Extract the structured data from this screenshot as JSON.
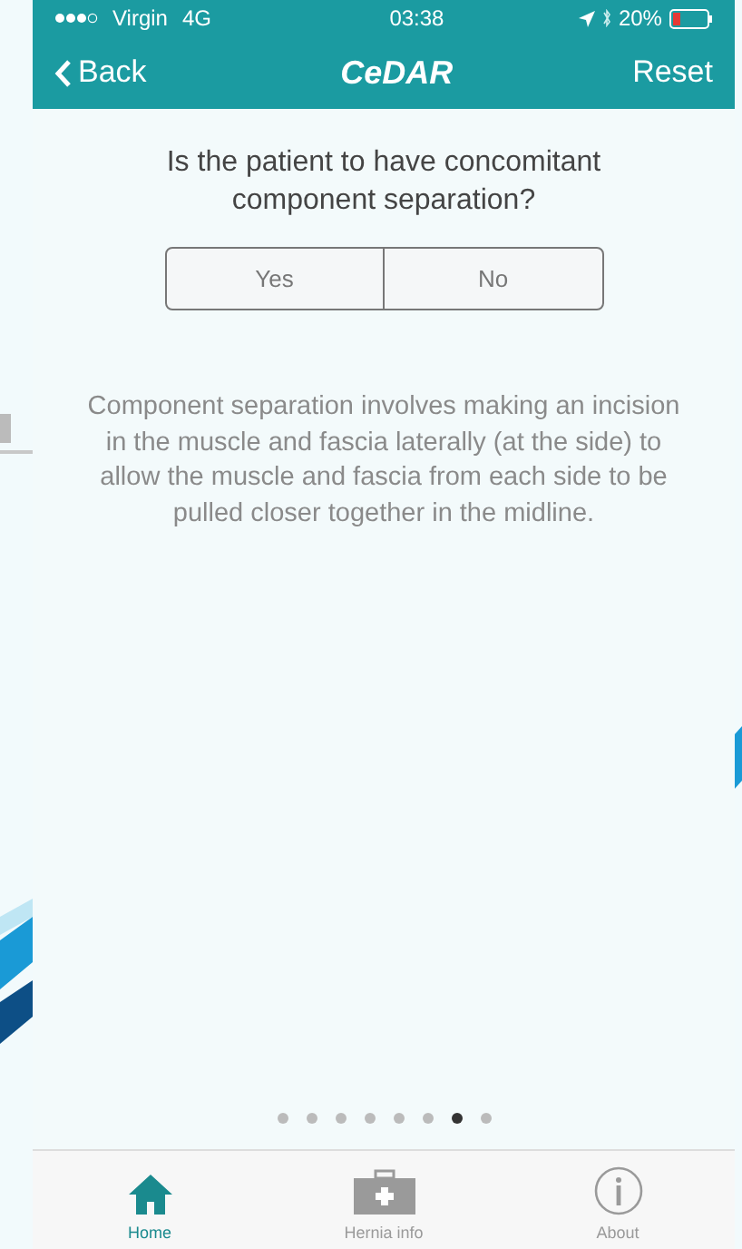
{
  "status_bar": {
    "carrier": "Virgin",
    "network": "4G",
    "time": "03:38",
    "battery": "20%"
  },
  "nav": {
    "back": "Back",
    "title": "CeDAR",
    "action": "Reset"
  },
  "question": "Is the patient to have concomitant component separation?",
  "options": [
    {
      "label": "Yes",
      "selected": false
    },
    {
      "label": "No",
      "selected": false
    }
  ],
  "description": "Component separation involves making an incision in the muscle and fascia laterally (at the side) to allow the muscle and fascia from each side to be pulled closer together in the midline.",
  "page_dots": [
    {
      "selected": false
    },
    {
      "selected": false
    },
    {
      "selected": false
    },
    {
      "selected": false
    },
    {
      "selected": false
    },
    {
      "selected": false
    },
    {
      "selected": true
    },
    {
      "selected": false
    }
  ],
  "tabs": [
    {
      "label": "Home",
      "kind": "home",
      "selected": true
    },
    {
      "label": "Hernia info",
      "kind": "kit",
      "selected": false
    },
    {
      "label": "About",
      "kind": "info",
      "selected": false
    }
  ]
}
